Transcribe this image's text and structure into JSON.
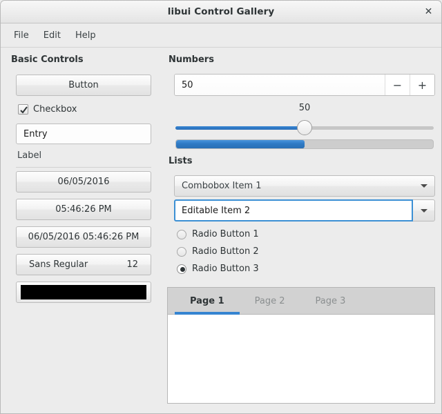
{
  "window": {
    "title": "libui Control Gallery",
    "close_label": "✕"
  },
  "menubar": {
    "items": [
      {
        "label": "File"
      },
      {
        "label": "Edit"
      },
      {
        "label": "Help"
      }
    ]
  },
  "basic_controls": {
    "title": "Basic Controls",
    "button_label": "Button",
    "checkbox_label": "Checkbox",
    "checkbox_checked": true,
    "entry_value": "Entry",
    "entry_placeholder": "Entry",
    "label_text": "Label",
    "date_button": "06/05/2016",
    "time_button": "05:46:26 PM",
    "datetime_button": "06/05/2016 05:46:26 PM",
    "font_name": "Sans Regular",
    "font_size": "12",
    "color_value": "#000000"
  },
  "numbers": {
    "title": "Numbers",
    "spinbox_value": "50",
    "spin_decrement": "−",
    "spin_increment": "+",
    "slider_value": "50",
    "slider_min": 0,
    "slider_max": 100,
    "progress_value": 50
  },
  "lists": {
    "title": "Lists",
    "combobox_value": "Combobox Item 1",
    "editable_combobox_value": "Editable Item 2",
    "editable_combobox_placeholder": "Editable Item 2",
    "radios": [
      {
        "label": "Radio Button 1",
        "selected": false
      },
      {
        "label": "Radio Button 2",
        "selected": false
      },
      {
        "label": "Radio Button 3",
        "selected": true
      }
    ]
  },
  "tabs": {
    "items": [
      {
        "label": "Page 1",
        "active": true
      },
      {
        "label": "Page 2",
        "active": false
      },
      {
        "label": "Page 3",
        "active": false
      }
    ]
  },
  "colors": {
    "accent": "#3584d1",
    "window_bg": "#ececec",
    "text": "#2e3436",
    "focus_border": "#3b8fd4"
  }
}
